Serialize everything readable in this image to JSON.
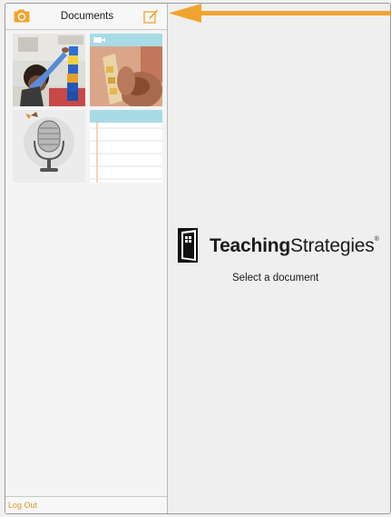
{
  "header": {
    "title": "Documents",
    "camera_icon": "camera-icon",
    "compose_icon": "compose-icon"
  },
  "documents": [
    {
      "kind": "photo",
      "icon": "photo-thumbnail"
    },
    {
      "kind": "video",
      "icon": "video-camera-icon"
    },
    {
      "kind": "audio",
      "icon": "microphone-icon"
    },
    {
      "kind": "note",
      "icon": "note-icon"
    }
  ],
  "footer": {
    "logout_label": "Log Out"
  },
  "main": {
    "brand_bold": "Teaching",
    "brand_light": "Strategies",
    "registered_mark": "®",
    "prompt": "Select a document"
  },
  "colors": {
    "accent": "#f0a430",
    "sidebar_bg": "#f4f4f4",
    "main_bg": "#efefef",
    "note_header": "#a8dbe6"
  }
}
